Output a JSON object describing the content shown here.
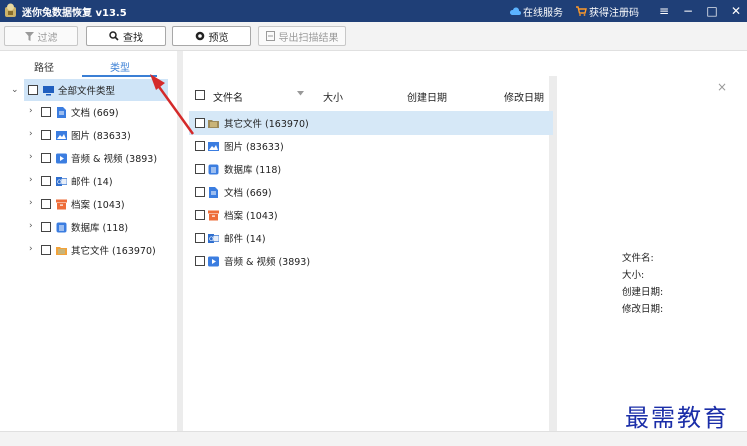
{
  "app": {
    "title": "迷你兔数据恢复 v13.5"
  },
  "titlebar": {
    "online_service": "在线服务",
    "get_code": "获得注册码"
  },
  "toolbar": {
    "filter": "过滤",
    "find": "查找",
    "preview": "预览",
    "export": "导出扫描结果"
  },
  "left_tabs": {
    "path": "路径",
    "type": "类型"
  },
  "tree": {
    "root": "全部文件类型",
    "items": [
      {
        "label": "文档 (669)",
        "icon": "document-icon",
        "color": "#3b7de0"
      },
      {
        "label": "图片 (83633)",
        "icon": "image-icon",
        "color": "#3b7de0"
      },
      {
        "label": "音频 & 视频 (3893)",
        "icon": "media-icon",
        "color": "#3b7de0"
      },
      {
        "label": "邮件 (14)",
        "icon": "mail-icon",
        "color": "#2f6fcf"
      },
      {
        "label": "档案 (1043)",
        "icon": "archive-icon",
        "color": "#ee6d3a"
      },
      {
        "label": "数据库 (118)",
        "icon": "database-icon",
        "color": "#3b7de0"
      },
      {
        "label": "其它文件 (163970)",
        "icon": "other-files-icon",
        "color": "#f2a23a"
      }
    ]
  },
  "table": {
    "headers": {
      "name": "文件名",
      "size": "大小",
      "created": "创建日期",
      "modified": "修改日期"
    },
    "rows": [
      {
        "label": "其它文件 (163970)",
        "icon": "other-files-icon",
        "color": "#9c8a5a"
      },
      {
        "label": "图片 (83633)",
        "icon": "image-icon",
        "color": "#3b7de0"
      },
      {
        "label": "数据库 (118)",
        "icon": "database-icon",
        "color": "#3b7de0"
      },
      {
        "label": "文档 (669)",
        "icon": "document-icon",
        "color": "#3b7de0"
      },
      {
        "label": "档案 (1043)",
        "icon": "archive-icon",
        "color": "#ee6d3a"
      },
      {
        "label": "邮件 (14)",
        "icon": "mail-icon",
        "color": "#2f6fcf"
      },
      {
        "label": "音频 & 视频 (3893)",
        "icon": "media-icon",
        "color": "#3b7de0"
      }
    ]
  },
  "details": {
    "name": "文件名:",
    "size": "大小:",
    "created": "创建日期:",
    "modified": "修改日期:"
  },
  "watermark": "最需教育",
  "colors": {
    "titlebar": "#1f3f77",
    "accent": "#3a7fd5",
    "selection": "#cfe4f7",
    "annotation_arrow": "#d42a2a"
  }
}
